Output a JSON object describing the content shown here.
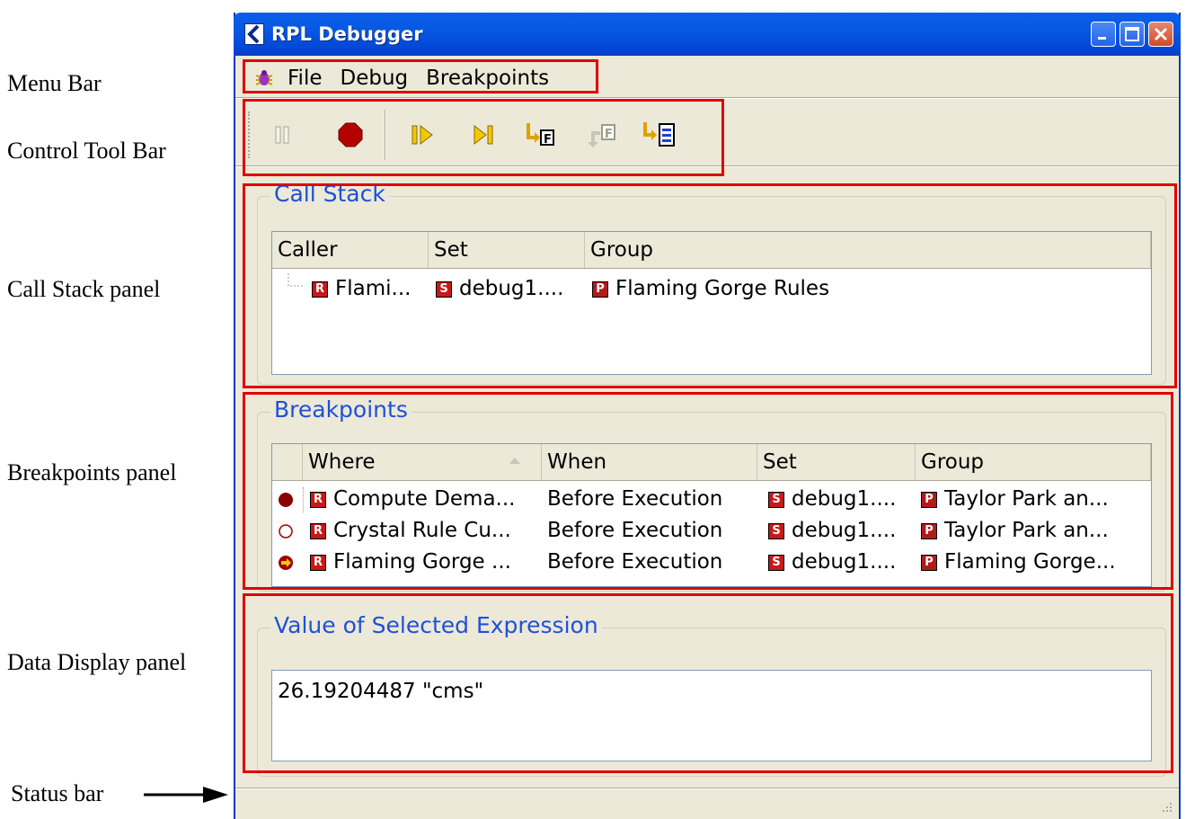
{
  "annotations": {
    "menu_bar": "Menu Bar",
    "control_tool_bar": "Control Tool Bar",
    "call_stack_panel": "Call Stack panel",
    "breakpoints_panel": "Breakpoints panel",
    "data_display_panel": "Data Display panel",
    "status_bar": "Status bar"
  },
  "window": {
    "title": "RPL Debugger"
  },
  "menu": {
    "items": [
      "File",
      "Debug",
      "Breakpoints"
    ]
  },
  "toolbar": {
    "tools": [
      "pause-icon",
      "stop-icon",
      "continue-icon",
      "step-icon",
      "step-into-function-icon",
      "step-out-function-icon",
      "step-to-block-icon"
    ]
  },
  "call_stack": {
    "title": "Call Stack",
    "columns": [
      "Caller",
      "Set",
      "Group"
    ],
    "rows": [
      {
        "caller": "Flami...",
        "set": "debug1....",
        "group": "Flaming Gorge Rules"
      }
    ]
  },
  "breakpoints": {
    "title": "Breakpoints",
    "columns": [
      "Where",
      "When",
      "Set",
      "Group"
    ],
    "rows": [
      {
        "state": "enabled",
        "where": "Compute Dema...",
        "when": "Before Execution",
        "set": "debug1....",
        "group": "Taylor Park an..."
      },
      {
        "state": "disabled",
        "where": "Crystal Rule Cu...",
        "when": "Before Execution",
        "set": "debug1....",
        "group": "Taylor Park an..."
      },
      {
        "state": "current",
        "where": "Flaming Gorge ...",
        "when": "Before Execution",
        "set": "debug1....",
        "group": "Flaming Gorge..."
      }
    ]
  },
  "value_panel": {
    "title": "Value of Selected Expression",
    "value": "26.19204487 \"cms\""
  },
  "colors": {
    "highlight_box": "#e00000",
    "group_title": "#1f50d8",
    "window_bg": "#ece9d8"
  }
}
